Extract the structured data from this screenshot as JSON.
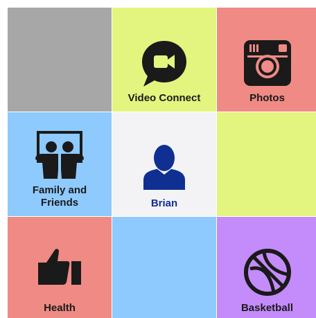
{
  "tiles": [
    {
      "name": "tile-empty-gray",
      "label": "",
      "color": "#a7a7a7",
      "icon": "none"
    },
    {
      "name": "tile-video-connect",
      "label": "Video Connect",
      "color": "#e3f57e",
      "icon": "video-chat-icon"
    },
    {
      "name": "tile-photos",
      "label": "Photos",
      "color": "#ef8a84",
      "icon": "camera-icon"
    },
    {
      "name": "tile-family-and-friends",
      "label": "Family and\nFriends",
      "color": "#8ecafd",
      "icon": "family-presentation-icon"
    },
    {
      "name": "tile-brian",
      "label": "Brian",
      "color": "#f3f3f5",
      "icon": "person-icon",
      "label_color": "#0f2f91"
    },
    {
      "name": "tile-empty-yellow",
      "label": "",
      "color": "#e3f57e",
      "icon": "none"
    },
    {
      "name": "tile-health",
      "label": "Health",
      "color": "#ef8a84",
      "icon": "thumbs-up-icon"
    },
    {
      "name": "tile-empty-blue",
      "label": "",
      "color": "#8ecafd",
      "icon": "none"
    },
    {
      "name": "tile-basketball",
      "label": "Basketball",
      "color": "#c48bfb",
      "icon": "basketball-icon"
    }
  ]
}
